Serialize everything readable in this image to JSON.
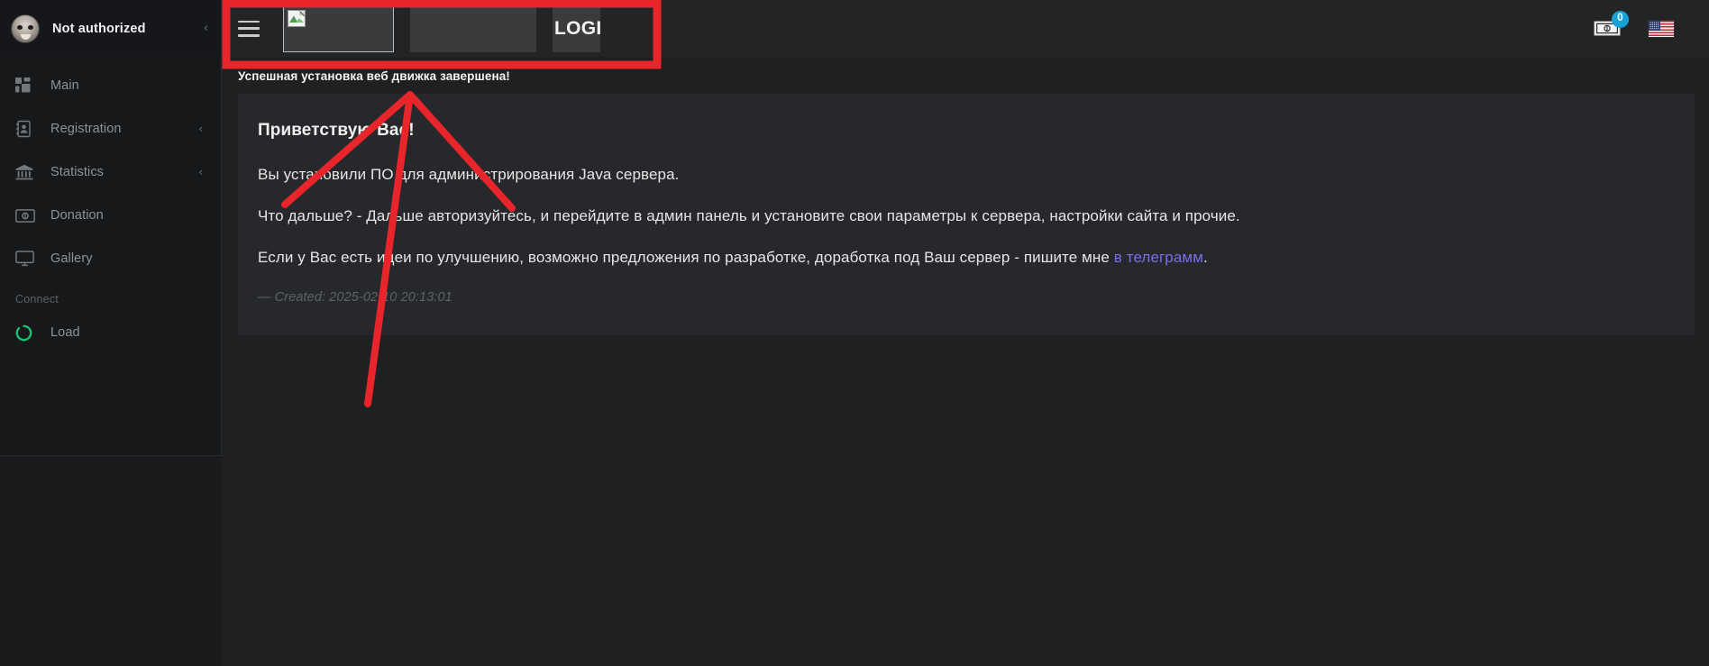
{
  "sidebar": {
    "user": {
      "name": "Not authorized",
      "avatar_icon": "monkey-avatar",
      "collapse_icon": "chevron-left-icon"
    },
    "items": [
      {
        "label": "Main",
        "icon": "grid-icon",
        "has_chevron": false
      },
      {
        "label": "Registration",
        "icon": "address-book-icon",
        "has_chevron": true,
        "chevron": "‹"
      },
      {
        "label": "Statistics",
        "icon": "bank-icon",
        "has_chevron": true,
        "chevron": "‹"
      },
      {
        "label": "Donation",
        "icon": "banknote-icon",
        "has_chevron": false
      },
      {
        "label": "Gallery",
        "icon": "monitor-icon",
        "has_chevron": false
      }
    ],
    "section_label": "Connect",
    "connect_items": [
      {
        "label": "Load",
        "icon": "loading-circle-icon"
      }
    ]
  },
  "navbar": {
    "menu_toggle_icon": "hamburger-icon",
    "logo_box": {
      "image_state": "broken-image",
      "alt": ""
    },
    "blank_box": "",
    "login_label": "LOGIN",
    "login_visible_text": "LOGI",
    "money_icon": "banknote-icon",
    "money_badge": "0",
    "language_flag": "us-flag-icon"
  },
  "content": {
    "alert_title": "Успешная установка веб движка завершена!",
    "heading": "Приветствую Вас!",
    "paragraph_1": "Вы установили ПО для администрирования Java сервера.",
    "paragraph_2": "Что дальше? - Дальше авторизуйтесь, и перейдите в админ панель и установите свои параметры к сервера, настройки сайта и прочие.",
    "paragraph_3_before": "Если у Вас есть идеи по улучшению, возможно предложения по разработке, доработка под Ваш сервер - пишите мне ",
    "paragraph_3_link": "в телеграмм",
    "paragraph_3_after": ".",
    "created": "— Created: 2025-02-10 20:13:01"
  },
  "colors": {
    "page_bg": "#1b1b1e",
    "sidebar_bg": "#16181a",
    "navbar_bg": "#232426",
    "content_bg": "#1e2022",
    "card_bg": "#26282b",
    "annotation_red": "#e8252b",
    "link_purple": "#7a6fe8",
    "badge_blue": "#17a2d6",
    "load_green": "#1dbf73"
  },
  "annotation": {
    "type": "highlight-rectangle-and-arrow",
    "target": "navbar-top-left-region",
    "color": "#e8252b"
  }
}
